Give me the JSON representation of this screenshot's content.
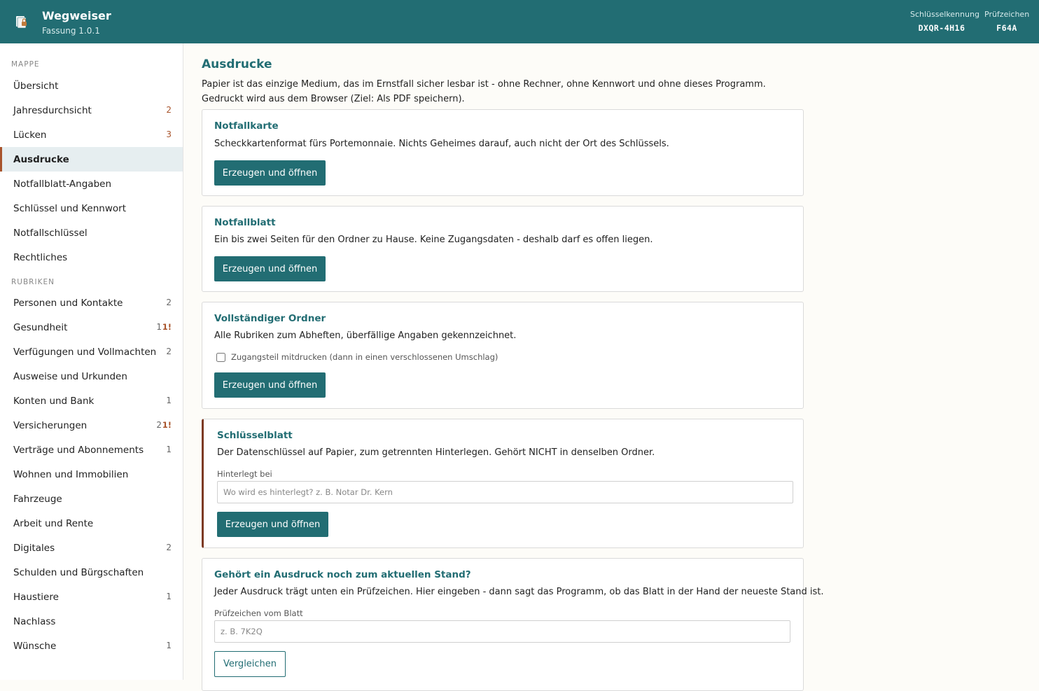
{
  "header": {
    "title": "Wegweiser",
    "version": "Fassung 1.0.1",
    "key_id_label": "Schlüsselkennung",
    "key_id_value": "DXQR-4H16",
    "check_label": "Prüfzeichen",
    "check_value": "F64A"
  },
  "sidebar": {
    "section_mappe": "MAPPE",
    "section_rubriken": "RUBRIKEN",
    "mappe_items": [
      {
        "label": "Übersicht"
      },
      {
        "label": "Jahresdurchsicht",
        "count": "2"
      },
      {
        "label": "Lücken",
        "count": "3"
      },
      {
        "label": "Ausdrucke",
        "active": true
      },
      {
        "label": "Notfallblatt-Angaben"
      },
      {
        "label": "Schlüssel und Kennwort"
      },
      {
        "label": "Notfallschlüssel"
      },
      {
        "label": "Rechtliches"
      }
    ],
    "rubriken_items": [
      {
        "label": "Personen und Kontakte",
        "count": "2"
      },
      {
        "label": "Gesundheit",
        "count": "1",
        "warn": "1!"
      },
      {
        "label": "Verfügungen und Vollmachten",
        "count": "2"
      },
      {
        "label": "Ausweise und Urkunden"
      },
      {
        "label": "Konten und Bank",
        "count": "1"
      },
      {
        "label": "Versicherungen",
        "count": "2",
        "warn": "1!"
      },
      {
        "label": "Verträge und Abonnements",
        "count": "1"
      },
      {
        "label": "Wohnen und Immobilien"
      },
      {
        "label": "Fahrzeuge"
      },
      {
        "label": "Arbeit und Rente"
      },
      {
        "label": "Digitales",
        "count": "2"
      },
      {
        "label": "Schulden und Bürgschaften"
      },
      {
        "label": "Haustiere",
        "count": "1"
      },
      {
        "label": "Nachlass"
      },
      {
        "label": "Wünsche",
        "count": "1"
      }
    ]
  },
  "main": {
    "title": "Ausdrucke",
    "intro": "Papier ist das einzige Medium, das im Ernstfall sicher lesbar ist - ohne Rechner, ohne Kennwort und ohne dieses Programm. Gedruckt wird aus dem Browser (Ziel: Als PDF speichern).",
    "notfallkarte": {
      "title": "Notfallkarte",
      "text": "Scheckkartenformat fürs Portemonnaie. Nichts Geheimes darauf, auch nicht der Ort des Schlüssels.",
      "button": "Erzeugen und öffnen"
    },
    "notfallblatt": {
      "title": "Notfallblatt",
      "text": "Ein bis zwei Seiten für den Ordner zu Hause. Keine Zugangsdaten - deshalb darf es offen liegen.",
      "button": "Erzeugen und öffnen"
    },
    "ordner": {
      "title": "Vollständiger Ordner",
      "text": "Alle Rubriken zum Abheften, überfällige Angaben gekennzeichnet.",
      "checkbox_label": "Zugangsteil mitdrucken (dann in einen verschlossenen Umschlag)",
      "button": "Erzeugen und öffnen"
    },
    "schluesselblatt": {
      "title": "Schlüsselblatt",
      "text": "Der Datenschlüssel auf Papier, zum getrennten Hinterlegen. Gehört NICHT in denselben Ordner.",
      "field_label": "Hinterlegt bei",
      "placeholder": "Wo wird es hinterlegt? z. B. Notar Dr. Kern",
      "button": "Erzeugen und öffnen"
    },
    "pruefung": {
      "title": "Gehört ein Ausdruck noch zum aktuellen Stand?",
      "text": "Jeder Ausdruck trägt unten ein Prüfzeichen. Hier eingeben - dann sagt das Programm, ob das Blatt in der Hand der neueste Stand ist.",
      "field_label": "Prüfzeichen vom Blatt",
      "placeholder": "z. B. 7K2Q",
      "button": "Vergleichen"
    }
  },
  "colors": {
    "brand": "#226d73",
    "accent": "#a8542c"
  }
}
